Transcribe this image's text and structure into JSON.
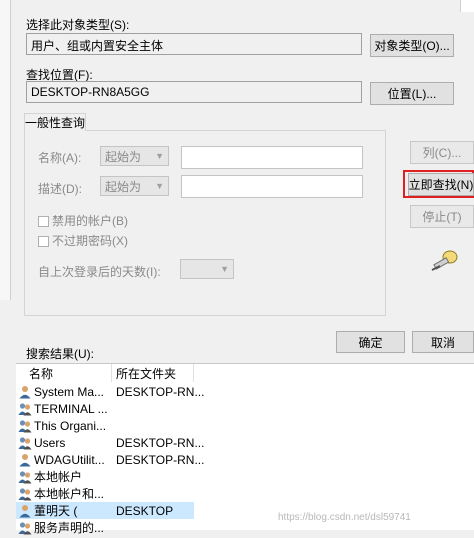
{
  "object_type": {
    "label": "选择此对象类型(S):",
    "value": "用户、组或内置安全主体",
    "button": "对象类型(O)..."
  },
  "location": {
    "label": "查找位置(F):",
    "value": "DESKTOP-RN8A5GG",
    "button": "位置(L)..."
  },
  "tab": {
    "label": "一般性查询"
  },
  "query": {
    "name_label": "名称(A):",
    "name_mode": "起始为",
    "desc_label": "描述(D):",
    "desc_mode": "起始为",
    "disabled_accounts": "禁用的帐户(B)",
    "non_expiring": "不过期密码(X)",
    "days_label": "自上次登录后的天数(I):"
  },
  "buttons": {
    "columns": "列(C)...",
    "find_now": "立即查找(N)",
    "stop": "停止(T)",
    "ok": "确定",
    "cancel": "取消"
  },
  "results": {
    "label": "搜索结果(U):",
    "columns": [
      "名称",
      "所在文件夹"
    ],
    "rows": [
      {
        "name": "System Ma...",
        "folder": "DESKTOP-RN...",
        "icon": "user-icon"
      },
      {
        "name": "TERMINAL ...",
        "folder": "",
        "icon": "group-icon"
      },
      {
        "name": "This Organi...",
        "folder": "",
        "icon": "group-icon"
      },
      {
        "name": "Users",
        "folder": "DESKTOP-RN...",
        "icon": "group-icon"
      },
      {
        "name": "WDAGUtilit...",
        "folder": "DESKTOP-RN...",
        "icon": "user-icon"
      },
      {
        "name": "本地帐户",
        "folder": "",
        "icon": "group-icon"
      },
      {
        "name": "本地帐户和...",
        "folder": "",
        "icon": "group-icon"
      },
      {
        "name": "董明天 (",
        "folder": "DESKTOP",
        "icon": "user-icon"
      },
      {
        "name": "服务声明的...",
        "folder": "",
        "icon": "group-icon"
      }
    ]
  },
  "watermark": "https://blog.csdn.net/dsl59741",
  "colors": {
    "highlight_border": "#e02020",
    "selected_row": "#cce8ff"
  }
}
